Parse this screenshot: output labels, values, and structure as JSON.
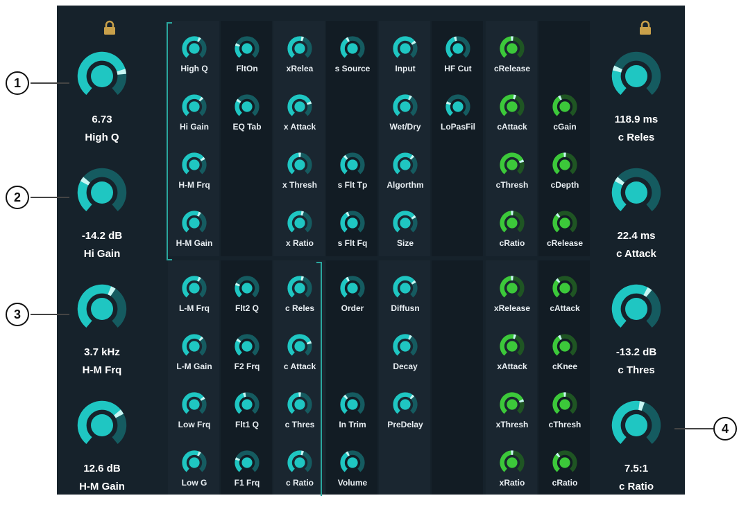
{
  "callouts": [
    "1",
    "2",
    "3",
    "4"
  ],
  "left_column": [
    {
      "value": "6.73",
      "name": "High Q",
      "level": 0.78
    },
    {
      "value": "-14.2 dB",
      "name": "Hi Gain",
      "level": 0.3
    },
    {
      "value": "3.7 kHz",
      "name": "H-M Frq",
      "level": 0.6
    },
    {
      "value": "12.6 dB",
      "name": "H-M Gain",
      "level": 0.7
    }
  ],
  "right_column": [
    {
      "value": "118.9 ms",
      "name": "c Reles",
      "level": 0.25
    },
    {
      "value": "22.4 ms",
      "name": "c Attack",
      "level": 0.3
    },
    {
      "value": "-13.2 dB",
      "name": "c Thres",
      "level": 0.62
    },
    {
      "value": "7.5:1",
      "name": "c Ratio",
      "level": 0.55
    }
  ],
  "grid_top": [
    [
      "High Q",
      "FltOn",
      "xRelea",
      "s Source",
      "Input",
      "HF Cut",
      "cRelease",
      ""
    ],
    [
      "Hi Gain",
      "EQ Tab",
      "x Attack",
      "",
      "Wet/Dry",
      "LoPasFil",
      "cAttack",
      "cGain"
    ],
    [
      "H-M Frq",
      "",
      "x Thresh",
      "s Flt Tp",
      "Algorthm",
      "",
      "cThresh",
      "cDepth"
    ],
    [
      "H-M Gain",
      "",
      "x Ratio",
      "s Flt Fq",
      "Size",
      "",
      "cRatio",
      "cRelease"
    ]
  ],
  "grid_bottom": [
    [
      "L-M Frq",
      "Flt2 Q",
      "c Reles",
      "Order",
      "Diffusn",
      "",
      "xRelease",
      "cAttack"
    ],
    [
      "L-M Gain",
      "F2 Frq",
      "c Attack",
      "",
      "Decay",
      "",
      "xAttack",
      "cKnee"
    ],
    [
      "Low Frq",
      "Flt1 Q",
      "c Thres",
      "In Trim",
      "PreDelay",
      "",
      "xThresh",
      "cThresh"
    ],
    [
      "Low G",
      "F1 Frq",
      "c Ratio",
      "Volume",
      "",
      "",
      "xRatio",
      "cRatio"
    ]
  ],
  "colors": {
    "background": "#16222b",
    "cyan": "#1fc6c2",
    "cyan_dark": "#155b60",
    "green": "#3cc83a",
    "green_dark": "#1f5523",
    "lock": "#c8a04a"
  }
}
